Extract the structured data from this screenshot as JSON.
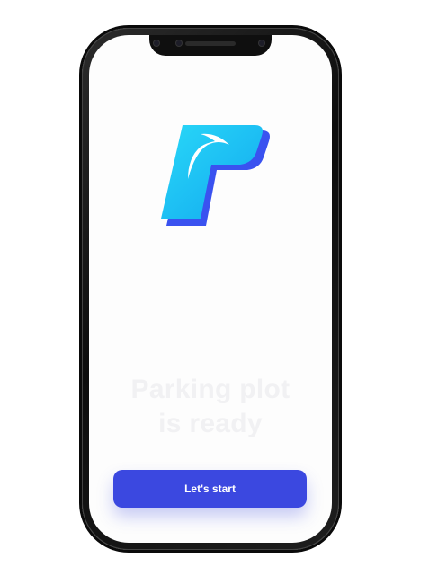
{
  "app": {
    "headline_line1": "Parking plot",
    "headline_line2": "is ready",
    "start_button_label": "Let's start"
  },
  "icons": {
    "logo": "parking-p-logo-icon"
  },
  "colors": {
    "accent": "#3b48e0",
    "logo_cyan": "#1ec8f5",
    "logo_blue": "#3a52f0",
    "screen_bg": "#fdfdfd",
    "headline_text": "#f1f1f3"
  }
}
